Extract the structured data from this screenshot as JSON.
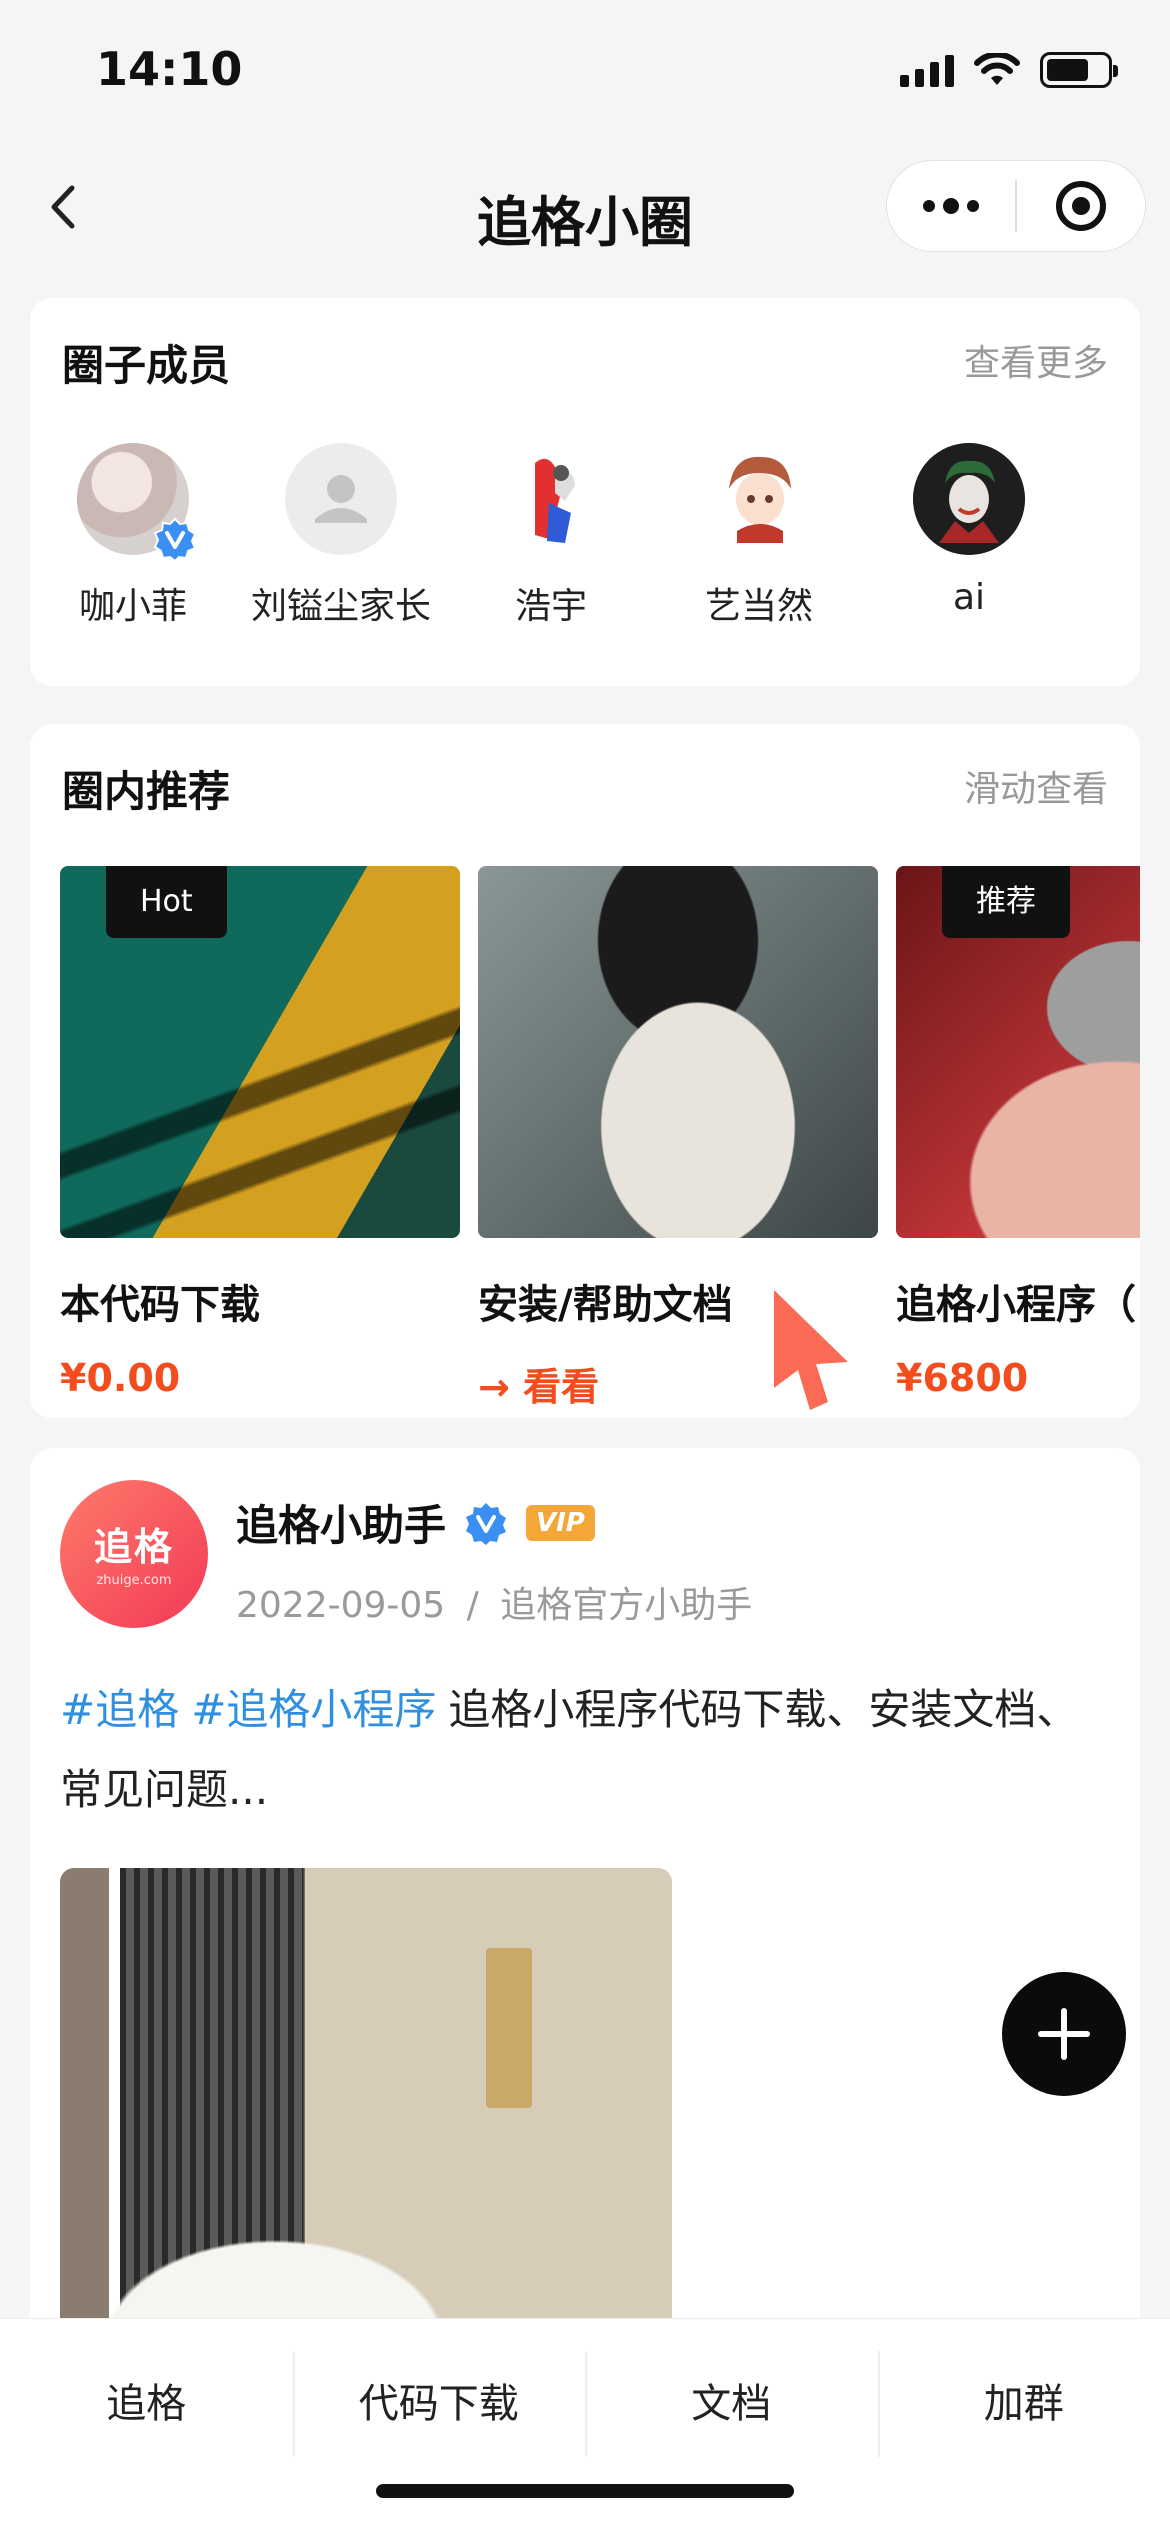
{
  "status_bar": {
    "time": "14:10"
  },
  "navbar": {
    "title": "追格小圈"
  },
  "members_section": {
    "title": "圈子成员",
    "more": "查看更多",
    "members": [
      {
        "name": "咖小菲",
        "verified": true
      },
      {
        "name": "刘镒尘家长"
      },
      {
        "name": "浩宇"
      },
      {
        "name": "艺当然"
      },
      {
        "name": "ai"
      }
    ]
  },
  "recommend_section": {
    "title": "圈内推荐",
    "more": "滑动查看",
    "items": [
      {
        "tag": "Hot",
        "name": "本代码下载",
        "price": "¥0.00"
      },
      {
        "name": "安装/帮助文档",
        "price": "→ 看看"
      },
      {
        "tag": "推荐",
        "name": "追格小程序（",
        "price": "¥6800"
      }
    ]
  },
  "post": {
    "avatar_text": "追格",
    "avatar_sub": "zhuige.com",
    "author": "追格小助手",
    "vip": "VIP",
    "date": "2022-09-05",
    "separator": "/",
    "source": "追格官方小助手",
    "tags": [
      "#追格",
      "#追格小程序"
    ],
    "text": "追格小程序代码下载、安装文档、常见问题..."
  },
  "tabbar": {
    "tabs": [
      "追格",
      "代码下载",
      "文档",
      "加群"
    ]
  },
  "colors": {
    "accent_price": "#f34d1d",
    "tag_blue": "#2f8fe0",
    "vip": "#f4a639"
  }
}
